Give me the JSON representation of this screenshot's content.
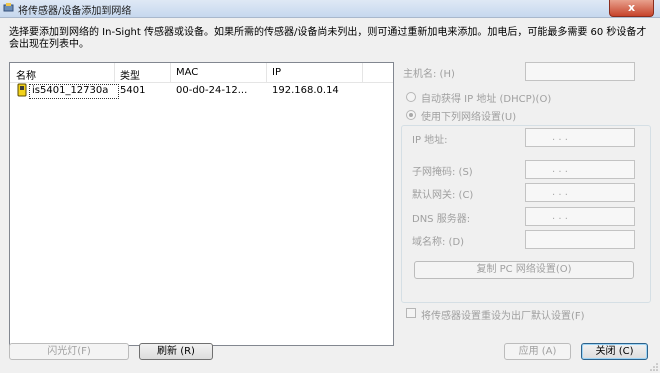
{
  "window": {
    "title": "将传感器/设备添加到网络",
    "close_label": "x"
  },
  "instructions": "选择要添加到网络的 In-Sight 传感器或设备。如果所需的传感器/设备尚未列出，则可通过重新加电来添加。加电后，可能最多需要 60 秒设备才会出现在列表中。",
  "list": {
    "columns": [
      "名称",
      "类型",
      "MAC",
      "IP"
    ],
    "rows": [
      {
        "name": "is5401_12730a",
        "type": "5401",
        "mac": "00-d0-24-12...",
        "ip": "192.168.0.14"
      }
    ]
  },
  "settings": {
    "hostname_label": "主机名:  (H)",
    "dhcp_label": "自动获得 IP 地址 (DHCP)(O)",
    "static_label": "使用下列网络设置(U)",
    "ip_label": "IP 地址:",
    "subnet_label": "子网掩码:  (S)",
    "gateway_label": "默认网关:  (C)",
    "dns_label": "DNS 服务器:",
    "domain_label": "域名称:  (D)",
    "copy_button": "复制 PC 网络设置(O)",
    "reset_label": "将传感器设置重设为出厂默认设置(F)",
    "ip_placeholder": ".        .        ."
  },
  "buttons": {
    "flash": "闪光灯(F)",
    "refresh": "刷新 (R)",
    "apply": "应用 (A)",
    "close": "关闭 (C)"
  },
  "colors": {
    "title_gradient_top": "#dfe9f5",
    "close_button": "#c7432b",
    "disabled_text": "#a0a0a0"
  }
}
